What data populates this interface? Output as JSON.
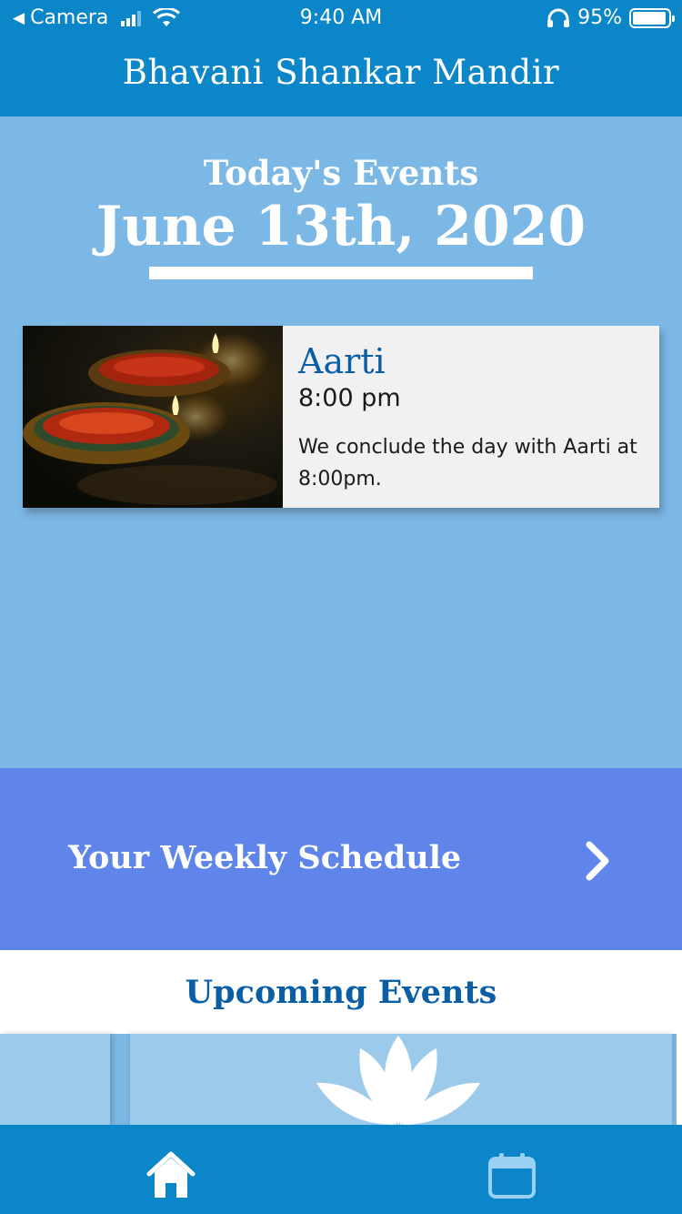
{
  "status_bar": {
    "back_app": "Camera",
    "time": "9:40 AM",
    "battery": "95%"
  },
  "header": {
    "title": "Bhavani Shankar Mandir"
  },
  "today": {
    "label": "Today's Events",
    "date": "June 13th, 2020"
  },
  "event": {
    "title": "Aarti",
    "time": "8:00 pm",
    "description": "We conclude the day with Aarti at 8:00pm.",
    "image": "diya-lamps-photo"
  },
  "weekly": {
    "label": "Your Weekly Schedule",
    "icon": "chevron-right-icon"
  },
  "upcoming": {
    "title": "Upcoming Events",
    "card_image": "lotus-logo"
  },
  "tab_bar": {
    "items": [
      {
        "name": "home",
        "icon": "home-icon",
        "active": true
      },
      {
        "name": "calendar",
        "icon": "calendar-icon",
        "active": false
      }
    ]
  },
  "colors": {
    "primary": "#0a86c9",
    "background": "#7cb8e5",
    "weekly": "#5f84ea",
    "title_text": "#0a5ea6",
    "card": "#f1f1f1",
    "upcoming_card": "#9bcaea"
  }
}
